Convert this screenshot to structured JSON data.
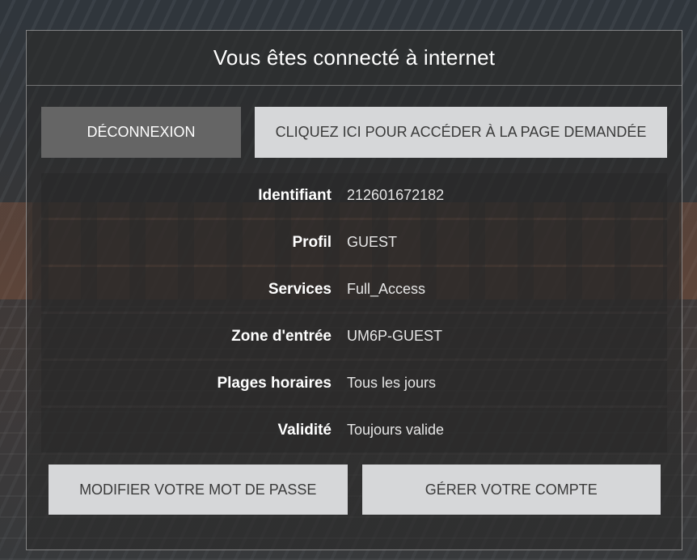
{
  "header": {
    "title": "Vous êtes connecté à internet"
  },
  "actions": {
    "logout_label": "DÉCONNEXION",
    "continue_label": "CLIQUEZ ICI POUR ACCÉDER À LA PAGE DEMANDÉE",
    "change_password_label": "MODIFIER VOTRE MOT DE PASSE",
    "manage_account_label": "GÉRER VOTRE COMPTE"
  },
  "info": [
    {
      "label": "Identifiant",
      "value": "212601672182"
    },
    {
      "label": "Profil",
      "value": "GUEST"
    },
    {
      "label": "Services",
      "value": "Full_Access"
    },
    {
      "label": "Zone d'entrée",
      "value": "UM6P-GUEST"
    },
    {
      "label": "Plages horaires",
      "value": "Tous les jours"
    },
    {
      "label": "Validité",
      "value": "Toujours valide"
    }
  ]
}
